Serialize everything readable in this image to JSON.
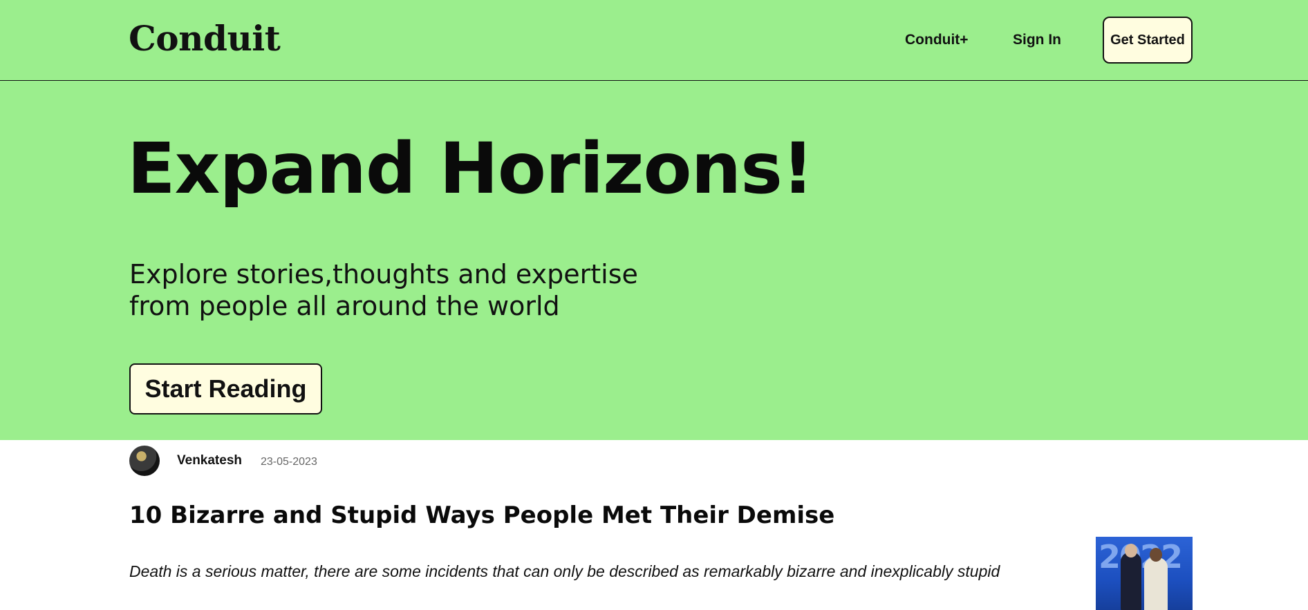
{
  "header": {
    "logo": "Conduit",
    "nav": {
      "conduit_plus": "Conduit+",
      "sign_in": "Sign In",
      "get_started": "Get Started"
    }
  },
  "hero": {
    "title": "Expand Horizons!",
    "subtitle_line1": "Explore stories,thoughts and expertise",
    "subtitle_line2": "from people all around the world",
    "cta": "Start Reading"
  },
  "article": {
    "author": "Venkatesh",
    "date": "23-05-2023",
    "title": "10 Bizarre and Stupid Ways People Met Their Demise",
    "description": "Death is a serious matter, there are some incidents that can only be described as remarkably bizarre and inexplicably stupid",
    "thumbnail_text": "2022"
  },
  "colors": {
    "hero_bg": "#9bee8d",
    "button_bg": "#fffde0",
    "text": "#111111",
    "muted": "#666666"
  }
}
